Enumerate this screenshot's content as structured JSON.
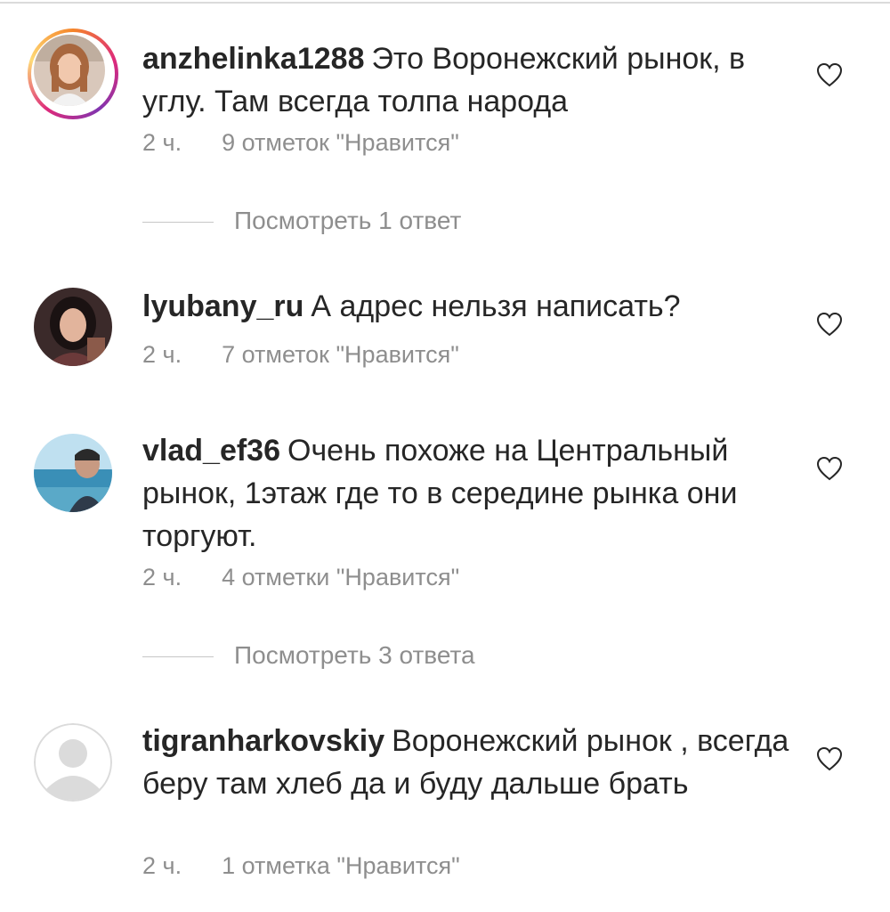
{
  "comments": [
    {
      "username": "anzhelinka1288",
      "text": "Это Воронежский рынок, в углу. Там всегда толпа народа",
      "time": "2 ч.",
      "likes": "9 отметок \"Нравится\"",
      "icons": {
        "avatar": "avatar-photo-icon",
        "like": "heart-outline-icon"
      }
    },
    {
      "username": "lyubany_ru",
      "text": "А адрес нельзя написать?",
      "time": "2 ч.",
      "likes": "7 отметок \"Нравится\"",
      "icons": {
        "avatar": "avatar-photo-icon",
        "like": "heart-outline-icon"
      }
    },
    {
      "username": "vlad_ef36",
      "text": "Очень похоже на Центральный рынок, 1этаж где то в середине рынка они торгуют.",
      "time": "2 ч.",
      "likes": "4 отметки \"Нравится\"",
      "icons": {
        "avatar": "avatar-photo-icon",
        "like": "heart-outline-icon"
      }
    },
    {
      "username": "tigranharkovskiy",
      "text": "Воронежский рынок , всегда беру там хлеб да и буду дальше брать",
      "time": "2 ч.",
      "likes": "1 отметка \"Нравится\"",
      "icons": {
        "avatar": "default-avatar-icon",
        "like": "heart-outline-icon"
      }
    }
  ],
  "replies": [
    {
      "label": "Посмотреть 1 ответ"
    },
    {
      "label": "Посмотреть 3 ответа"
    }
  ],
  "colors": {
    "text": "#262626",
    "secondary": "#8e8e8e",
    "ring_start": "#f58529",
    "ring_end": "#dd2a7b"
  }
}
